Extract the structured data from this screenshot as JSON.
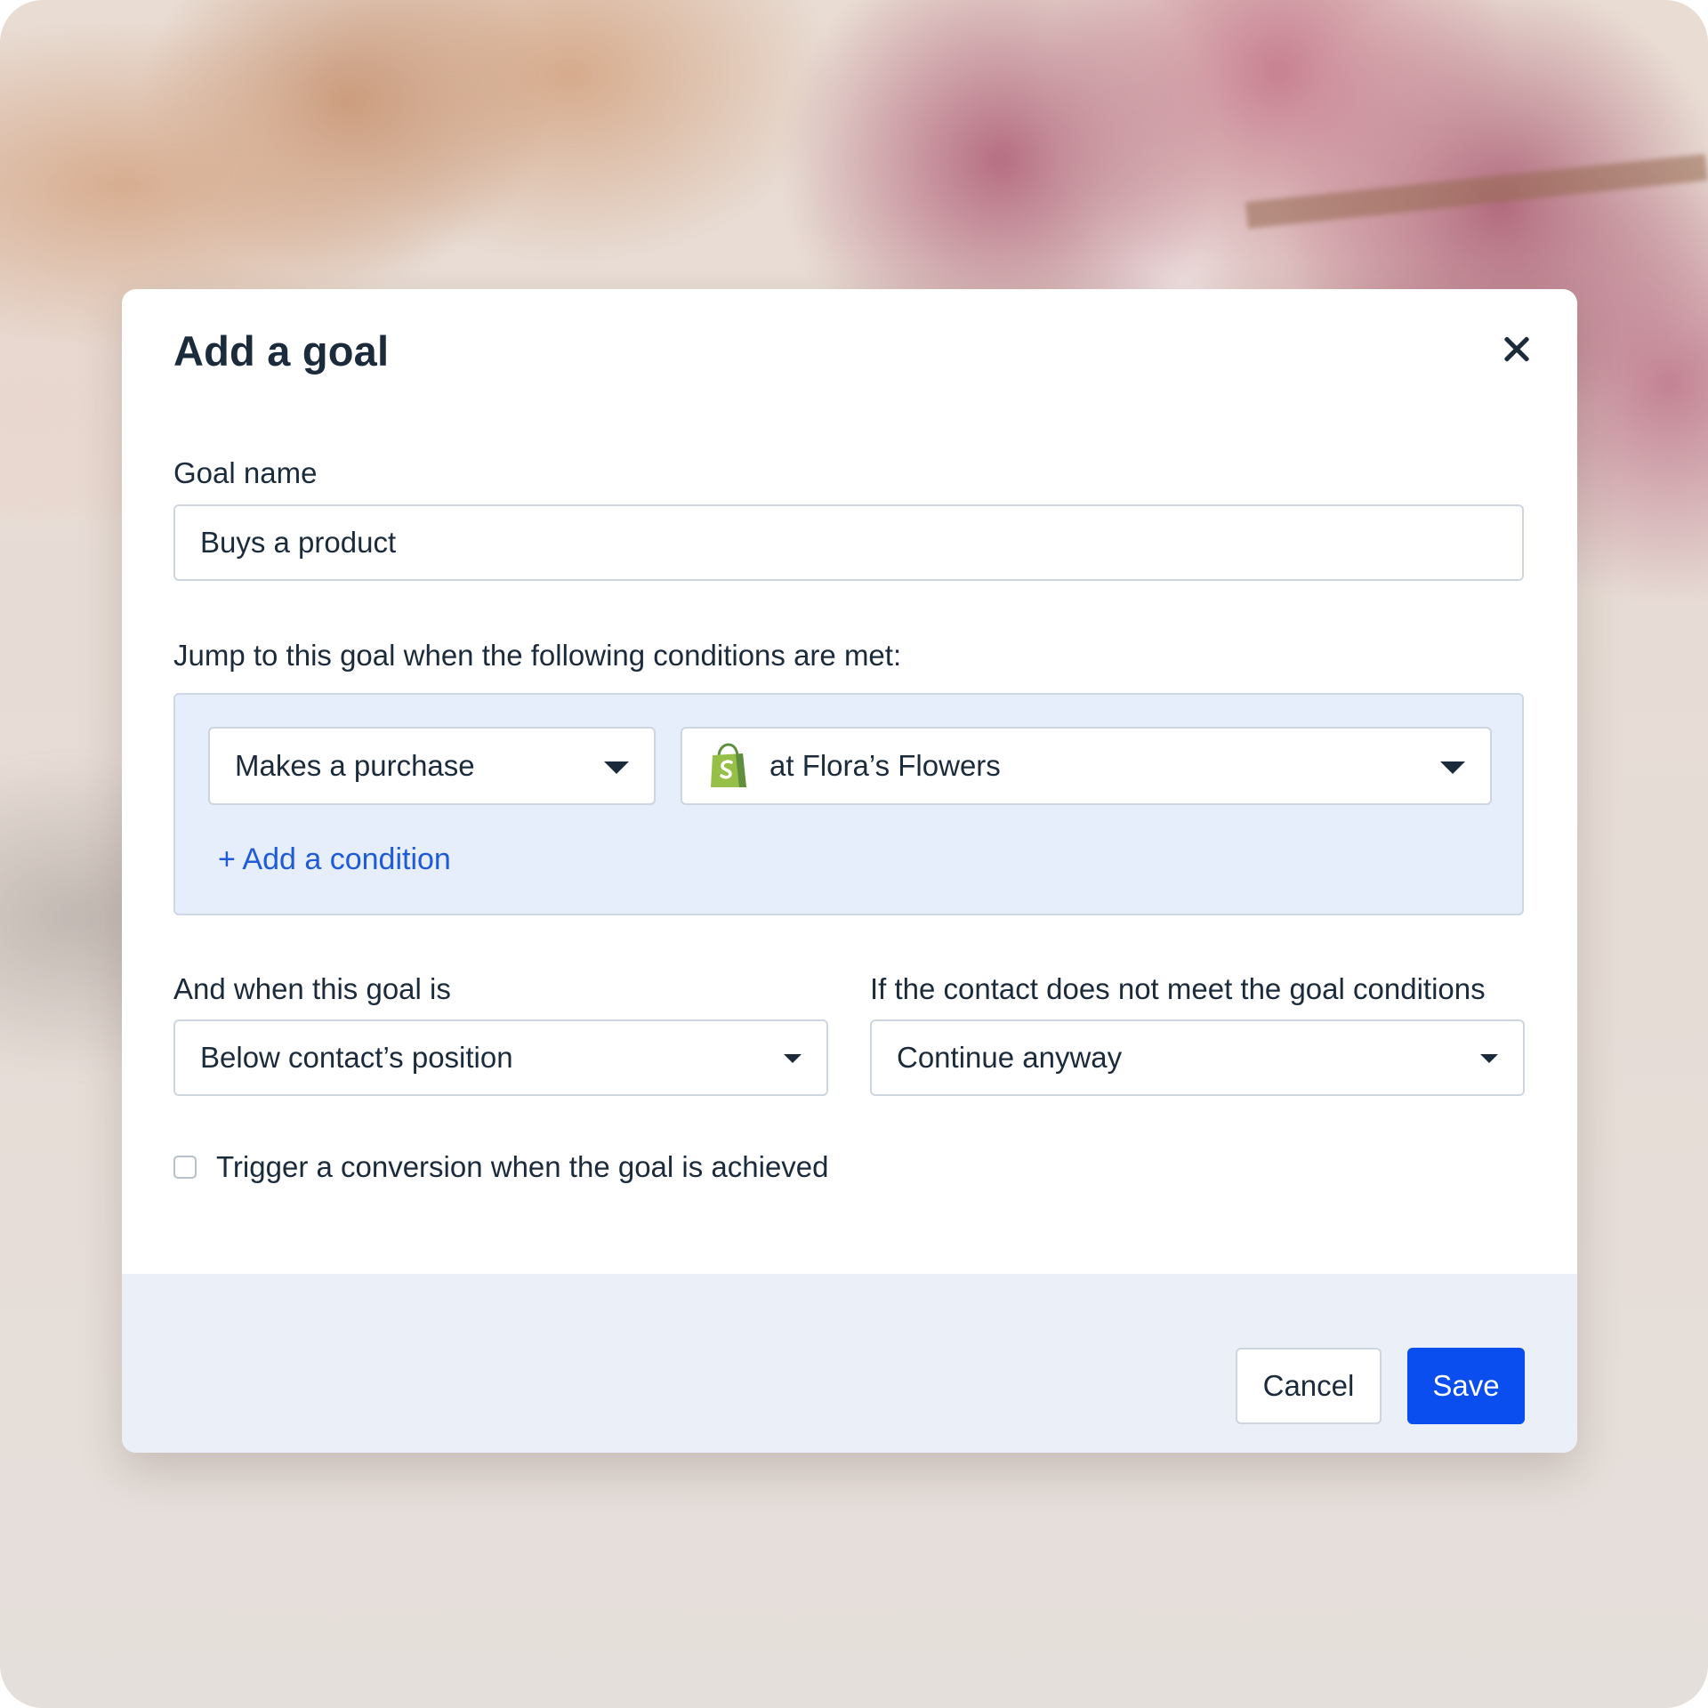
{
  "dialog": {
    "title": "Add a goal",
    "goal_name": {
      "label": "Goal name",
      "value": "Buys a product"
    },
    "conditions": {
      "label": "Jump to this goal when the following conditions are met:",
      "action_select": "Makes a purchase",
      "store_select": "at Flora’s Flowers",
      "store_icon": "shopify-bag-icon",
      "add_condition": "+ Add a condition"
    },
    "position": {
      "label": "And when this goal is",
      "value": "Below contact’s position"
    },
    "fallback": {
      "label": "If the contact does not meet the goal conditions",
      "value": "Continue anyway"
    },
    "conversion_checkbox": {
      "label": "Trigger a conversion when the goal is achieved",
      "checked": false
    },
    "footer": {
      "cancel_label": "Cancel",
      "save_label": "Save"
    }
  },
  "colors": {
    "primary": "#0a4ef0",
    "link": "#1f5bd8",
    "conditions_bg": "#e6edfb",
    "footer_bg": "#ebeff8",
    "text": "#1c2b3b",
    "shopify_green": "#95bf47"
  }
}
